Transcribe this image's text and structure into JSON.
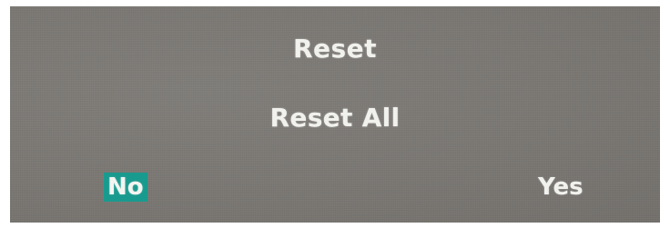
{
  "dialog": {
    "title": "Reset",
    "message": "Reset All",
    "options": {
      "no_label": "No",
      "yes_label": "Yes",
      "selected": "No"
    }
  },
  "colors": {
    "background": "#7a7773",
    "text": "#f1f1ee",
    "highlight": "#199a8e"
  }
}
